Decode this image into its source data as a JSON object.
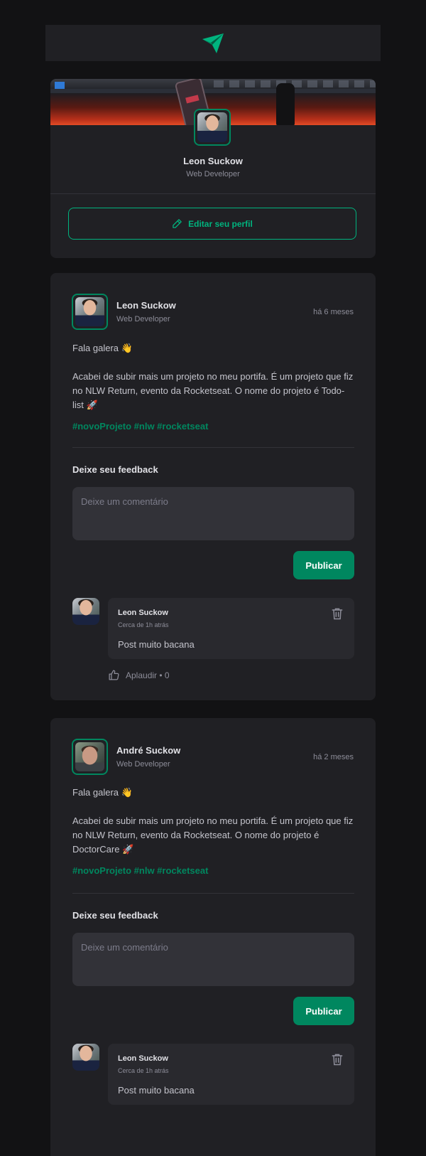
{
  "header": {
    "logo_icon": "ignite-logo-icon"
  },
  "profile": {
    "name": "Leon Suckow",
    "role": "Web Developer",
    "edit_label": "Editar seu perfil"
  },
  "posts": [
    {
      "author": "Leon Suckow",
      "role": "Web Developer",
      "time": "há 6 meses",
      "greeting": "Fala galera 👋",
      "body": "Acabei de subir mais um projeto no meu portifa. É um projeto que fiz no NLW Return, evento da Rocketseat. O nome do projeto é Todo-list 🚀",
      "tags": "#novoProjeto #nlw #rocketseat",
      "feedback_title": "Deixe seu feedback",
      "placeholder": "Deixe um comentário",
      "publish_label": "Publicar",
      "comment": {
        "author": "Leon Suckow",
        "time": "Cerca de 1h atrás",
        "text": "Post muito bacana",
        "applaud": "Aplaudir • 0"
      }
    },
    {
      "author": "André Suckow",
      "role": "Web Developer",
      "time": "há 2 meses",
      "greeting": "Fala galera 👋",
      "body": "Acabei de subir mais um projeto no meu portifa. É um projeto que fiz no NLW Return, evento da Rocketseat. O nome do projeto é DoctorCare 🚀",
      "tags": "#novoProjeto #nlw #rocketseat",
      "feedback_title": "Deixe seu feedback",
      "placeholder": "Deixe um comentário",
      "publish_label": "Publicar",
      "comment": {
        "author": "Leon Suckow",
        "time": "Cerca de 1h atrás",
        "text": "Post muito bacana"
      }
    }
  ],
  "colors": {
    "background": "#121214",
    "card": "#202024",
    "brand_green": "#00875f",
    "brand_green_light": "#00b37e"
  }
}
